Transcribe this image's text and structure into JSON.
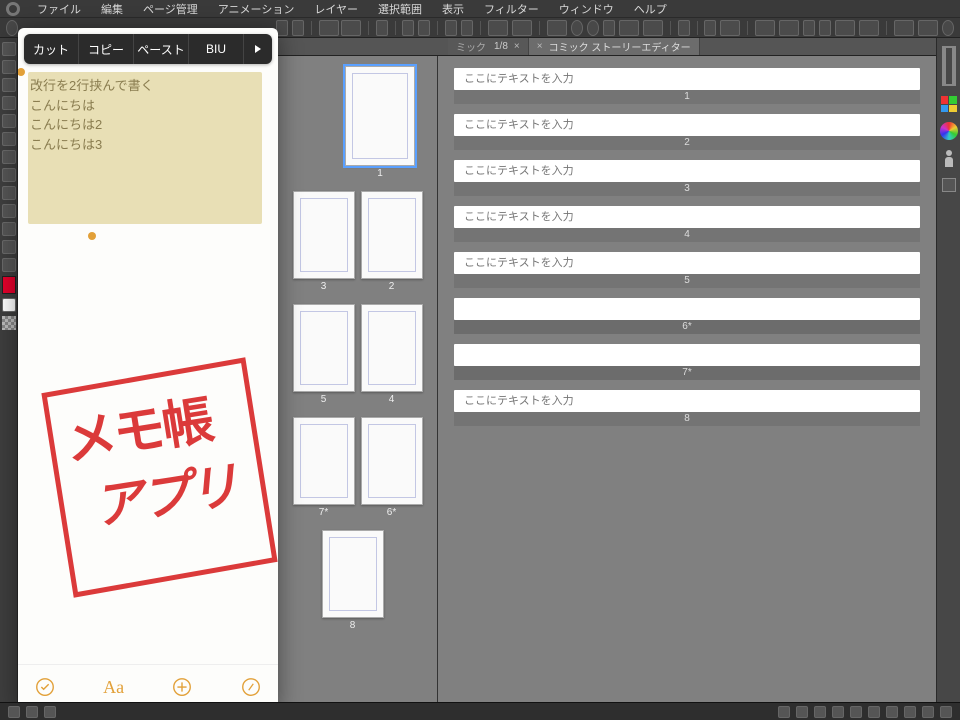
{
  "menu": {
    "items": [
      "ファイル",
      "編集",
      "ページ管理",
      "アニメーション",
      "レイヤー",
      "選択範囲",
      "表示",
      "フィルター",
      "ウィンドウ",
      "ヘルプ"
    ]
  },
  "tabs": {
    "comic_prefix": "ミック",
    "page_indicator": "1/8",
    "story_tab": "コミック ストーリーエディター",
    "close_glyph": "×"
  },
  "pages": {
    "thumbs": [
      {
        "row": "single",
        "labels": [
          "1"
        ],
        "selected": [
          true
        ]
      },
      {
        "row": "spread",
        "labels": [
          "3",
          "2"
        ]
      },
      {
        "row": "spread",
        "labels": [
          "5",
          "4"
        ]
      },
      {
        "row": "spread",
        "labels": [
          "7*",
          "6*"
        ]
      },
      {
        "row": "single_center",
        "labels": [
          "8"
        ]
      }
    ]
  },
  "story": {
    "placeholder": "ここにテキストを入力",
    "rows": [
      {
        "n": "1",
        "has": true
      },
      {
        "n": "2",
        "has": true
      },
      {
        "n": "3",
        "has": true
      },
      {
        "n": "4",
        "has": true
      },
      {
        "n": "5",
        "has": true
      },
      {
        "n": "6*",
        "has": false
      },
      {
        "n": "7*",
        "has": false
      },
      {
        "n": "8",
        "has": true
      }
    ]
  },
  "notes": {
    "toolbar": {
      "cut": "カット",
      "copy": "コピー",
      "paste": "ペースト",
      "biu": "BIU",
      "more": "▶"
    },
    "lines": [
      "改行を2行挟んで書く",
      "",
      "",
      "こんにちは",
      "",
      "",
      "こんにちは2",
      "",
      "",
      "こんにちは3"
    ],
    "stamp_line1": "メモ帳",
    "stamp_line2": "アプリ",
    "bottom": {
      "aa": "Aa"
    }
  }
}
